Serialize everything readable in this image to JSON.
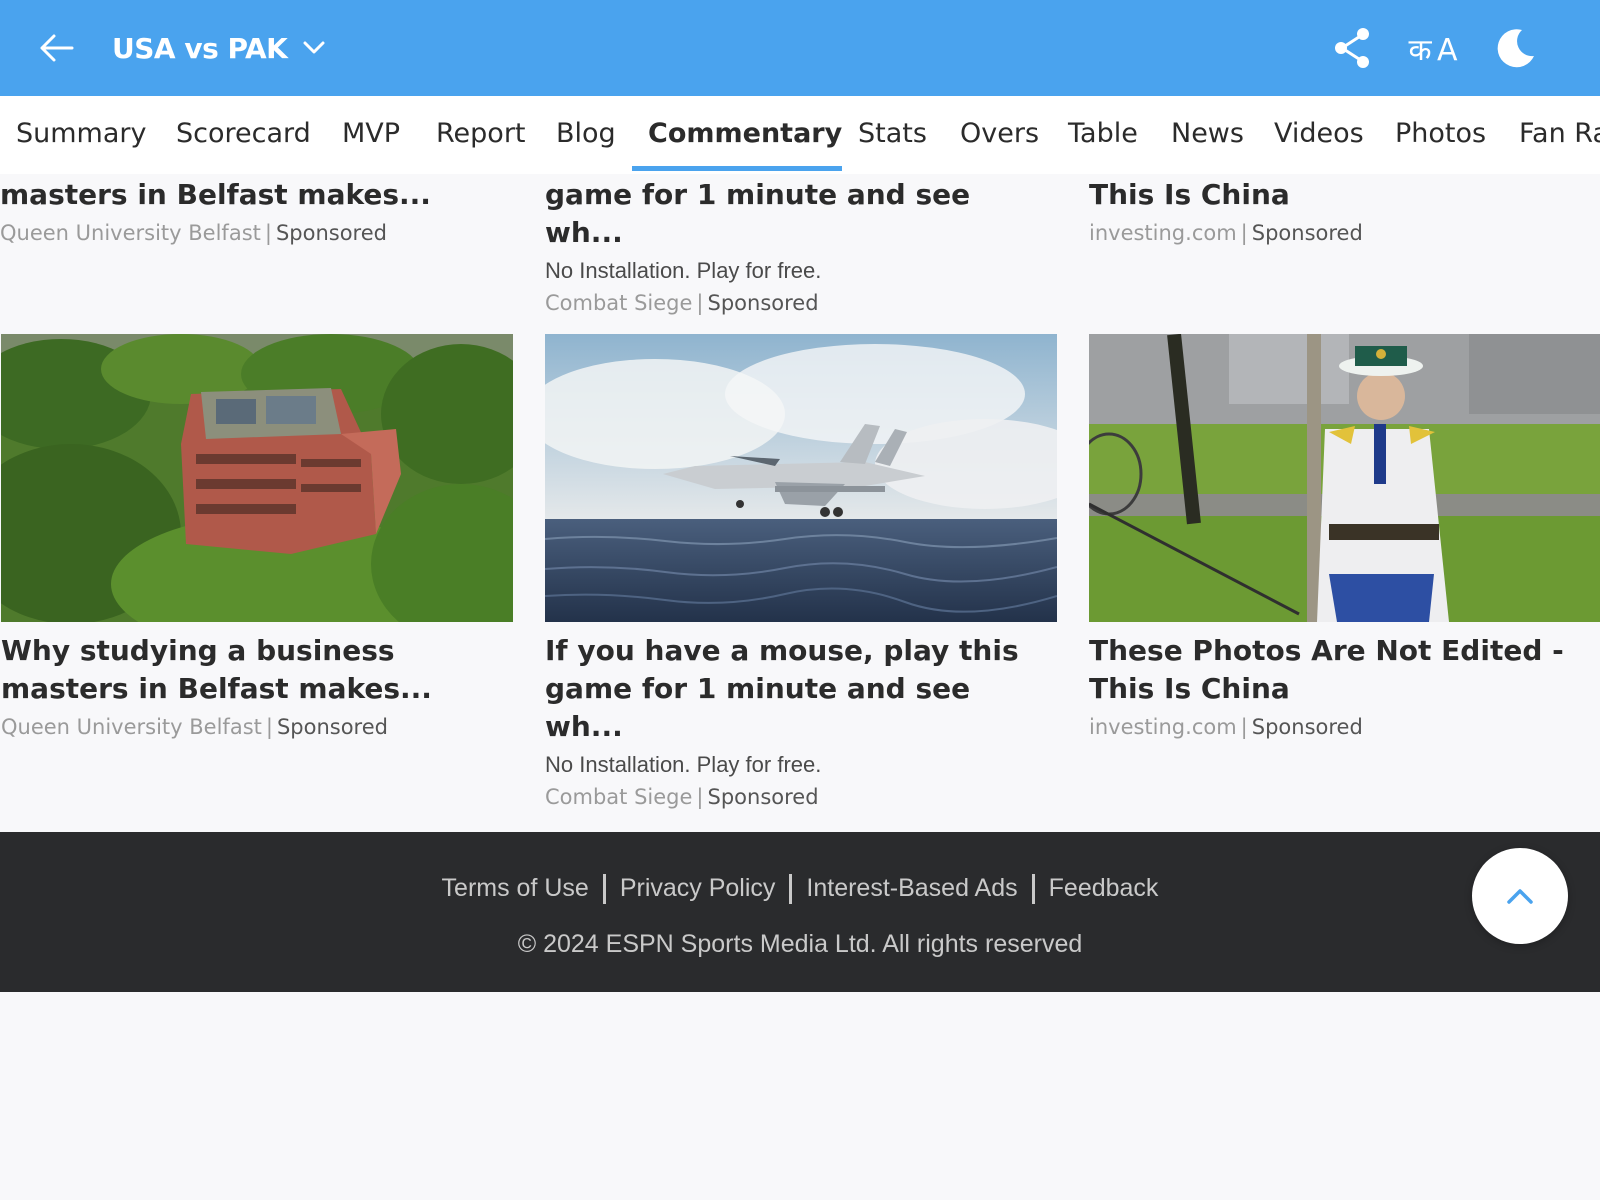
{
  "header": {
    "back_icon": "back-arrow-icon",
    "title": "USA vs PAK",
    "title_dropdown_icon": "chevron-down-icon",
    "share_icon": "share-icon",
    "language_icon": "language-toggle-icon",
    "language_glyph": "क A",
    "dark_mode_icon": "moon-icon"
  },
  "tabs": [
    {
      "label": "Summary"
    },
    {
      "label": "Scorecard"
    },
    {
      "label": "MVP"
    },
    {
      "label": "Report"
    },
    {
      "label": "Blog"
    },
    {
      "label": "Commentary",
      "active": true
    },
    {
      "label": "Stats"
    },
    {
      "label": "Overs"
    },
    {
      "label": "Table"
    },
    {
      "label": "News"
    },
    {
      "label": "Videos"
    },
    {
      "label": "Photos"
    },
    {
      "label": "Fan Ratings"
    }
  ],
  "ads_partial": [
    {
      "title_tail": "masters in Belfast makes...",
      "source": "Queen University Belfast",
      "sponsored": "Sponsored"
    },
    {
      "title_tail": "game for 1 minute and see wh...",
      "desc": "No Installation. Play for free.",
      "source": "Combat Siege",
      "sponsored": "Sponsored"
    },
    {
      "title_tail": "This Is China",
      "source": "investing.com",
      "sponsored": "Sponsored"
    }
  ],
  "ads": [
    {
      "image": "aerial-campus-building-photo",
      "title_l1": "Why studying a business",
      "title_l2": "masters in Belfast makes...",
      "source": "Queen University Belfast",
      "sponsored": "Sponsored"
    },
    {
      "image": "fighter-jet-over-sea-photo",
      "title_l1": "If you have a mouse, play this",
      "title_l2": "game for 1 minute and see wh...",
      "desc": "No Installation. Play for free.",
      "source": "Combat Siege",
      "sponsored": "Sponsored"
    },
    {
      "image": "traffic-officer-photo",
      "title_l1": "These Photos Are Not Edited -",
      "title_l2": "This Is China",
      "source": "investing.com",
      "sponsored": "Sponsored"
    }
  ],
  "footer": {
    "links": [
      "Terms of Use",
      "Privacy Policy",
      "Interest-Based Ads",
      "Feedback"
    ],
    "copyright": "© 2024 ESPN Sports Media Ltd. All rights reserved"
  },
  "scroll_top_icon": "chevron-up-icon",
  "colors": {
    "header_bg": "#4aa3ee",
    "footer_bg": "#2a2b2d",
    "accent": "#4aa3ee",
    "page_bg": "#f8f8fa"
  }
}
